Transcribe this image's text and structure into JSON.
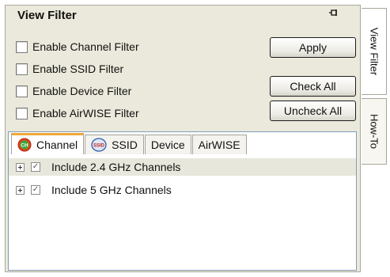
{
  "panel": {
    "title": "View Filter",
    "pin_icon": "pin-icon"
  },
  "filters": [
    {
      "label": "Enable Channel Filter",
      "checked": false
    },
    {
      "label": "Enable SSID Filter",
      "checked": false
    },
    {
      "label": "Enable Device Filter",
      "checked": false
    },
    {
      "label": "Enable AirWISE Filter",
      "checked": false
    }
  ],
  "buttons": {
    "apply": "Apply",
    "check_all": "Check All",
    "uncheck_all": "Uncheck All"
  },
  "tabs": [
    {
      "label": "Channel",
      "icon": "channel-icon",
      "icon_text": "CH",
      "active": true
    },
    {
      "label": "SSID",
      "icon": "ssid-icon",
      "icon_text": "SSID",
      "active": false
    },
    {
      "label": "Device",
      "active": false
    },
    {
      "label": "AirWISE",
      "active": false
    }
  ],
  "tree": [
    {
      "label": "Include 2.4 GHz Channels",
      "checked": true
    },
    {
      "label": "Include 5 GHz Channels",
      "checked": true
    }
  ],
  "side_tabs": [
    {
      "label": "View Filter"
    },
    {
      "label": "How-To"
    }
  ],
  "colors": {
    "panel_bg": "#ebe9db",
    "active_tab_accent": "#f0a838",
    "channel_icon": "#e8401c",
    "ssid_icon": "#2a5db0"
  }
}
